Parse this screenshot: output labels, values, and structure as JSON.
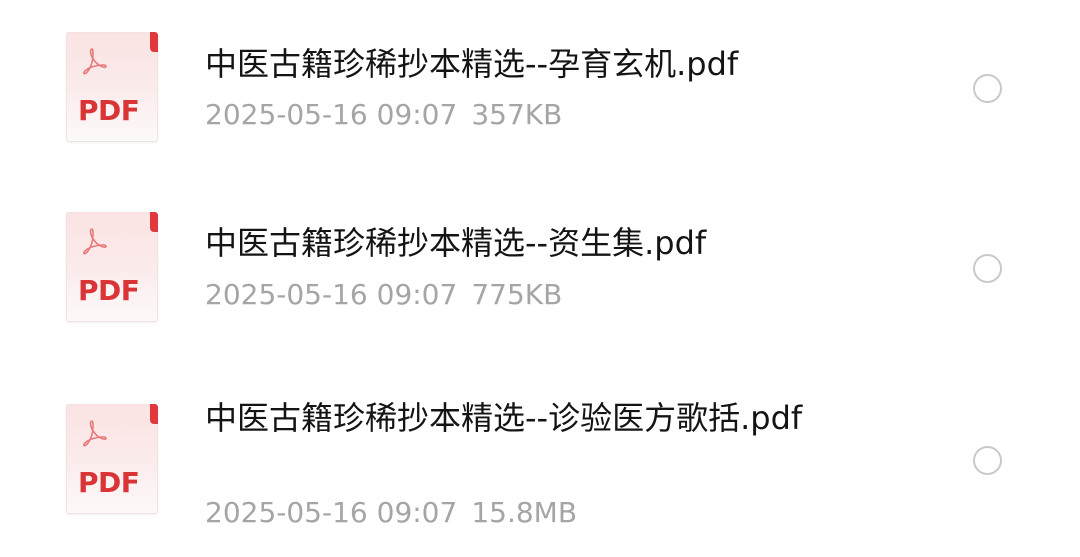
{
  "files": [
    {
      "icon": "pdf-file-icon",
      "badge": "PDF",
      "name": "中医古籍珍稀抄本精选--孕育玄机.pdf",
      "date": "2025-05-16 09:07",
      "size": "357KB",
      "selected": false
    },
    {
      "icon": "pdf-file-icon",
      "badge": "PDF",
      "name": "中医古籍珍稀抄本精选--资生集.pdf",
      "date": "2025-05-16 09:07",
      "size": "775KB",
      "selected": false
    },
    {
      "icon": "pdf-file-icon",
      "badge": "PDF",
      "name": "中医古籍珍稀抄本精选--诊验医方歌括.pdf",
      "date": "2025-05-16 09:07",
      "size": "15.8MB",
      "selected": false
    }
  ],
  "colors": {
    "pdf_red": "#d93436",
    "name_text": "#141414",
    "meta_text": "#a5a5a5",
    "radio_border": "#c9c9c9"
  }
}
